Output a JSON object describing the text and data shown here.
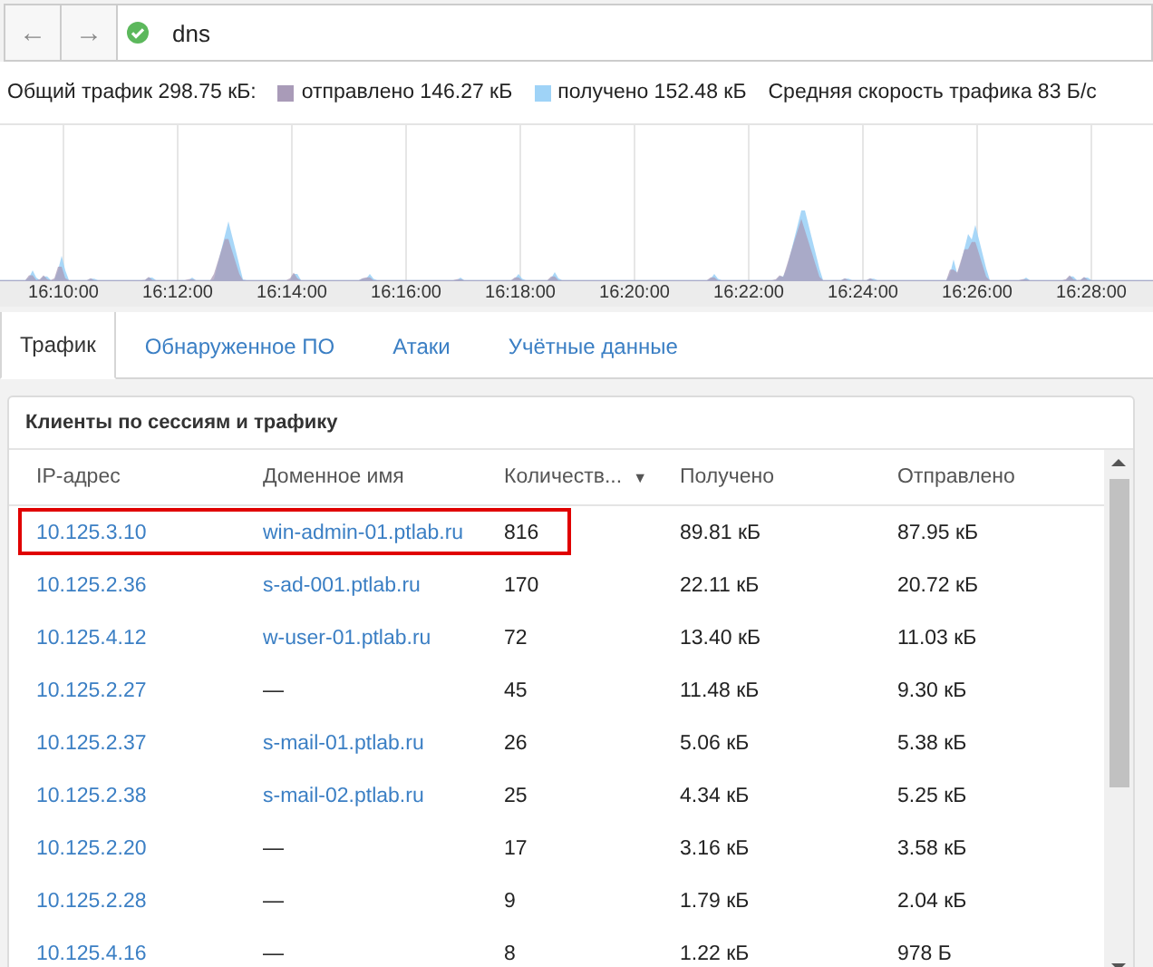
{
  "toolbar": {
    "back": "←",
    "forward": "→",
    "valid": true,
    "query": "dns"
  },
  "summary": {
    "total": "Общий трафик 298.75 кБ:",
    "legend": [
      {
        "label": "отправлено 146.27 кБ",
        "color": "#a99bb8"
      },
      {
        "label": "получено 152.48 кБ",
        "color": "#9fd3f7"
      }
    ],
    "rate": "Средняя скорость трафика 83 Б/с"
  },
  "timeline": {
    "time_labels": [
      "16:10:00",
      "16:12:00",
      "16:14:00",
      "16:16:00",
      "16:18:00",
      "16:20:00",
      "16:22:00",
      "16:24:00",
      "16:26:00",
      "16:28:00"
    ]
  },
  "tabs": [
    {
      "label": "Трафик",
      "selected": true
    },
    {
      "label": "Обнаруженное ПО",
      "selected": false
    },
    {
      "label": "Атаки",
      "selected": false
    },
    {
      "label": "Учётные данные",
      "selected": false
    }
  ],
  "panel": {
    "title": "Клиенты по сессиям и трафику",
    "columns": [
      {
        "label": "IP-адрес",
        "sorted": false
      },
      {
        "label": "Доменное имя",
        "sorted": false
      },
      {
        "label": "Количеств...",
        "sorted": true
      },
      {
        "label": "Получено",
        "sorted": false
      },
      {
        "label": "Отправлено",
        "sorted": false
      }
    ],
    "sort_icon": "▼",
    "rows": [
      {
        "ip": "10.125.3.10",
        "domain": {
          "text": "win-admin-01.ptlab.ru",
          "link": true
        },
        "count": "816",
        "received": "89.81 кБ",
        "sent": "87.95 кБ",
        "highlighted": true
      },
      {
        "ip": "10.125.2.36",
        "domain": {
          "text": "s-ad-001.ptlab.ru",
          "link": true
        },
        "count": "170",
        "received": "22.11 кБ",
        "sent": "20.72 кБ",
        "highlighted": false
      },
      {
        "ip": "10.125.4.12",
        "domain": {
          "text": "w-user-01.ptlab.ru",
          "link": true
        },
        "count": "72",
        "received": "13.40 кБ",
        "sent": "11.03 кБ",
        "highlighted": false
      },
      {
        "ip": "10.125.2.27",
        "domain": {
          "text": "—",
          "link": false
        },
        "count": "45",
        "received": "11.48 кБ",
        "sent": "9.30 кБ",
        "highlighted": false
      },
      {
        "ip": "10.125.2.37",
        "domain": {
          "text": "s-mail-01.ptlab.ru",
          "link": true
        },
        "count": "26",
        "received": "5.06 кБ",
        "sent": "5.38 кБ",
        "highlighted": false
      },
      {
        "ip": "10.125.2.38",
        "domain": {
          "text": "s-mail-02.ptlab.ru",
          "link": true
        },
        "count": "25",
        "received": "4.34 кБ",
        "sent": "5.25 кБ",
        "highlighted": false
      },
      {
        "ip": "10.125.2.20",
        "domain": {
          "text": "—",
          "link": false
        },
        "count": "17",
        "received": "3.16 кБ",
        "sent": "3.58 кБ",
        "highlighted": false
      },
      {
        "ip": "10.125.2.28",
        "domain": {
          "text": "—",
          "link": false
        },
        "count": "9",
        "received": "1.79 кБ",
        "sent": "2.04 кБ",
        "highlighted": false
      },
      {
        "ip": "10.125.4.16",
        "domain": {
          "text": "—",
          "link": false
        },
        "count": "8",
        "received": "1.22 кБ",
        "sent": "978 Б",
        "highlighted": false
      }
    ]
  }
}
